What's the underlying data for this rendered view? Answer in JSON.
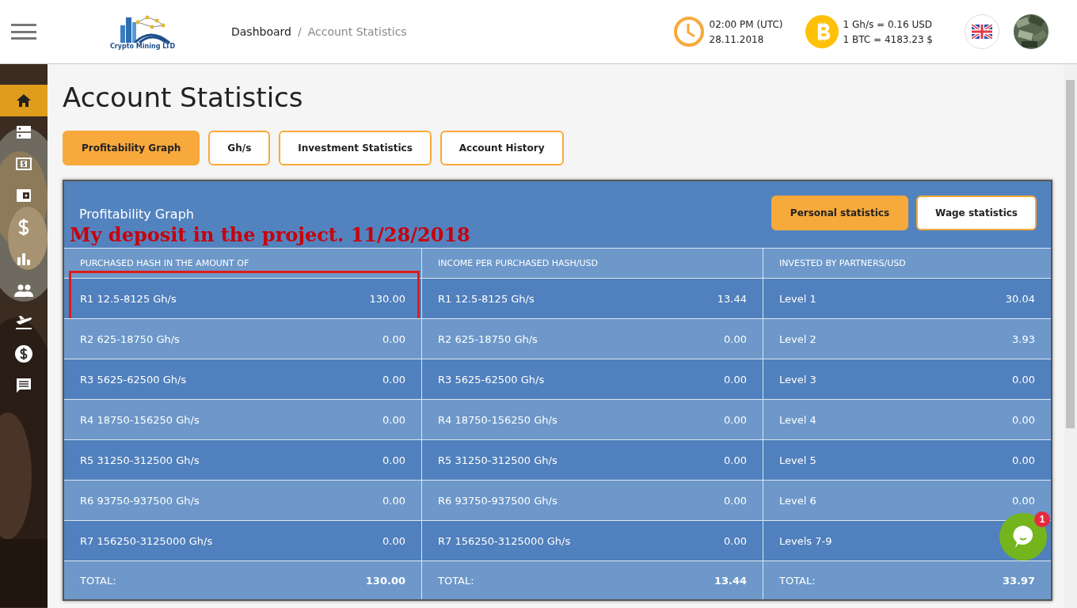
{
  "header": {
    "logo_text": "Crypto Mining LTD",
    "breadcrumb": [
      "Dashboard",
      "Account Statistics"
    ],
    "breadcrumb_separator": "/",
    "time": "02:00 PM (UTC)",
    "date": "28.11.2018",
    "rate_hash": "1 Gh/s = 0.16 USD",
    "rate_btc": "1 BTC = 4183.23 $"
  },
  "sidebar": {
    "items": [
      {
        "kind": "home",
        "selected": true
      },
      {
        "kind": "servers",
        "selected": false
      },
      {
        "kind": "cash",
        "selected": false
      },
      {
        "kind": "wallet",
        "selected": false
      },
      {
        "kind": "dollar",
        "selected": false
      },
      {
        "kind": "chart",
        "selected": false
      },
      {
        "kind": "people",
        "selected": false
      },
      {
        "kind": "plane",
        "selected": false
      },
      {
        "kind": "coin",
        "selected": false
      },
      {
        "kind": "chat",
        "selected": false
      }
    ]
  },
  "page_title": "Account Statistics",
  "tabs": [
    {
      "label": "Profitability Graph",
      "selected": true
    },
    {
      "label": "Gh/s",
      "selected": false
    },
    {
      "label": "Investment Statistics",
      "selected": false
    },
    {
      "label": "Account History",
      "selected": false
    }
  ],
  "panel": {
    "title": "Profitability Graph",
    "annotation": "My deposit in the project. 11/28/2018",
    "toggles": [
      {
        "label": "Personal statistics",
        "selected": true
      },
      {
        "label": "Wage statistics",
        "selected": false
      }
    ],
    "table": {
      "columns": [
        "PURCHASED HASH IN THE AMOUNT OF",
        "INCOME PER PURCHASED HASH/USD",
        "INVESTED BY PARTNERS/USD"
      ],
      "rows": [
        {
          "cells": [
            {
              "label": "R1 12.5-8125 Gh/s",
              "value": "130.00",
              "highlighted": true
            },
            {
              "label": "R1 12.5-8125 Gh/s",
              "value": "13.44",
              "highlighted": false
            },
            {
              "label": "Level 1",
              "value": "30.04",
              "highlighted": false
            }
          ]
        },
        {
          "cells": [
            {
              "label": "R2 625-18750 Gh/s",
              "value": "0.00",
              "highlighted": false
            },
            {
              "label": "R2 625-18750 Gh/s",
              "value": "0.00",
              "highlighted": false
            },
            {
              "label": "Level 2",
              "value": "3.93",
              "highlighted": false
            }
          ]
        },
        {
          "cells": [
            {
              "label": "R3 5625-62500 Gh/s",
              "value": "0.00",
              "highlighted": false
            },
            {
              "label": "R3 5625-62500 Gh/s",
              "value": "0.00",
              "highlighted": false
            },
            {
              "label": "Level 3",
              "value": "0.00",
              "highlighted": false
            }
          ]
        },
        {
          "cells": [
            {
              "label": "R4 18750-156250 Gh/s",
              "value": "0.00",
              "highlighted": false
            },
            {
              "label": "R4 18750-156250 Gh/s",
              "value": "0.00",
              "highlighted": false
            },
            {
              "label": "Level 4",
              "value": "0.00",
              "highlighted": false
            }
          ]
        },
        {
          "cells": [
            {
              "label": "R5 31250-312500 Gh/s",
              "value": "0.00",
              "highlighted": false
            },
            {
              "label": "R5 31250-312500 Gh/s",
              "value": "0.00",
              "highlighted": false
            },
            {
              "label": "Level 5",
              "value": "0.00",
              "highlighted": false
            }
          ]
        },
        {
          "cells": [
            {
              "label": "R6 93750-937500 Gh/s",
              "value": "0.00",
              "highlighted": false
            },
            {
              "label": "R6 93750-937500 Gh/s",
              "value": "0.00",
              "highlighted": false
            },
            {
              "label": "Level 6",
              "value": "0.00",
              "highlighted": false
            }
          ]
        },
        {
          "cells": [
            {
              "label": "R7 156250-3125000 Gh/s",
              "value": "0.00",
              "highlighted": false
            },
            {
              "label": "R7 156250-3125000 Gh/s",
              "value": "0.00",
              "highlighted": false
            },
            {
              "label": "Levels 7-9",
              "highlighted": false
            }
          ]
        }
      ],
      "totals": [
        {
          "label": "TOTAL:",
          "value": "130.00"
        },
        {
          "label": "TOTAL:",
          "value": "13.44"
        },
        {
          "label": "TOTAL:",
          "value": "33.97"
        }
      ]
    }
  },
  "chat": {
    "badge": "1"
  }
}
